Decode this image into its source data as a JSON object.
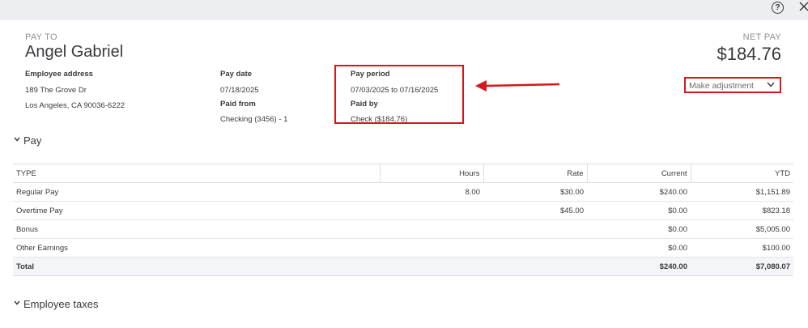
{
  "header": {
    "help_glyph": "?"
  },
  "pay_to": {
    "label": "PAY TO",
    "name": "Angel Gabriel"
  },
  "net_pay": {
    "label": "NET PAY",
    "amount": "$184.76"
  },
  "employee_address": {
    "label": "Employee address",
    "line1": "189 The Grove Dr",
    "line2": "Los Angeles, CA 90036-6222"
  },
  "pay_date": {
    "label": "Pay date",
    "value": "07/18/2025"
  },
  "paid_from": {
    "label": "Paid from",
    "value": "Checking (3456) - 1"
  },
  "pay_period": {
    "label": "Pay period",
    "value": "07/03/2025 to 07/16/2025"
  },
  "paid_by": {
    "label": "Paid by",
    "value": "Check ($184.76)"
  },
  "adjustment": {
    "label": "Make adjustment"
  },
  "sections": {
    "pay": "Pay",
    "employee_taxes": "Employee taxes"
  },
  "pay_table": {
    "columns": [
      "TYPE",
      "Hours",
      "Rate",
      "Current",
      "YTD"
    ],
    "rows": [
      [
        "Regular Pay",
        "8.00",
        "$30.00",
        "$240.00",
        "$1,151.89"
      ],
      [
        "Overtime Pay",
        "",
        "$45.00",
        "$0.00",
        "$823.18"
      ],
      [
        "Bonus",
        "",
        "",
        "$0.00",
        "$5,005.00"
      ],
      [
        "Other Earnings",
        "",
        "",
        "$0.00",
        "$100.00"
      ]
    ],
    "total": [
      "Total",
      "",
      "",
      "$240.00",
      "$7,080.07"
    ]
  },
  "colors": {
    "annotation_red": "#d4181c",
    "text": "#393a3d",
    "muted": "#8d9096",
    "topbar": "#eceef1"
  }
}
